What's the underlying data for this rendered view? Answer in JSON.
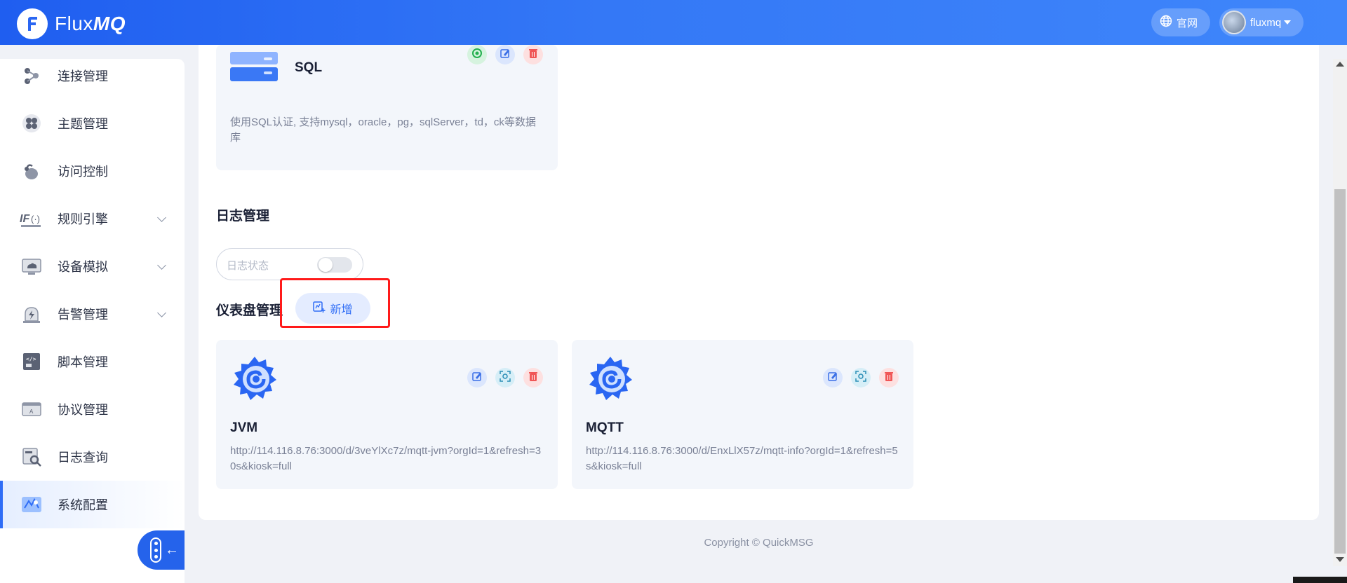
{
  "header": {
    "brand_plain": "Flux",
    "brand_bold": "MQ",
    "site_link": "官网",
    "username": "fluxmq",
    "icons": [
      "logo-f-icon",
      "globe-icon",
      "avatar",
      "caret-down-icon"
    ]
  },
  "sidebar": {
    "items": [
      {
        "label": "连接管理",
        "icon": "connection-icon"
      },
      {
        "label": "主题管理",
        "icon": "topic-icon"
      },
      {
        "label": "访问控制",
        "icon": "access-control-icon"
      },
      {
        "label": "规则引擎",
        "icon": "rule-engine-icon",
        "expandable": true
      },
      {
        "label": "设备模拟",
        "icon": "device-sim-icon",
        "expandable": true
      },
      {
        "label": "告警管理",
        "icon": "alarm-icon",
        "expandable": true
      },
      {
        "label": "脚本管理",
        "icon": "script-icon"
      },
      {
        "label": "协议管理",
        "icon": "protocol-icon"
      },
      {
        "label": "日志查询",
        "icon": "log-search-icon"
      },
      {
        "label": "系统配置",
        "icon": "system-config-icon",
        "active": true
      }
    ],
    "collapse_icon": "collapse-sidebar-icon"
  },
  "auth_card": {
    "title": "SQL",
    "description": "使用SQL认证, 支持mysql，oracle，pg，sqlServer，td，ck等数据库"
  },
  "log_section": {
    "title": "日志管理",
    "status_placeholder": "日志状态",
    "status_enabled": false
  },
  "dashboard_section": {
    "title": "仪表盘管理",
    "add_label": "新增",
    "cards": [
      {
        "title": "JVM",
        "url": "http://114.116.8.76:3000/d/3veYlXc7z/mqtt-jvm?orgId=1&refresh=30s&kiosk=full"
      },
      {
        "title": "MQTT",
        "url": "http://114.116.8.76:3000/d/EnxLlX57z/mqtt-info?orgId=1&refresh=5s&kiosk=full"
      }
    ]
  },
  "footer": {
    "copyright": "Copyright © QuickMSG"
  },
  "colors": {
    "header_start": "#1f5ef0",
    "header_end": "#3f86fb",
    "accent": "#2f6df6",
    "highlight": "#ff1a1a",
    "danger": "#f05656"
  }
}
